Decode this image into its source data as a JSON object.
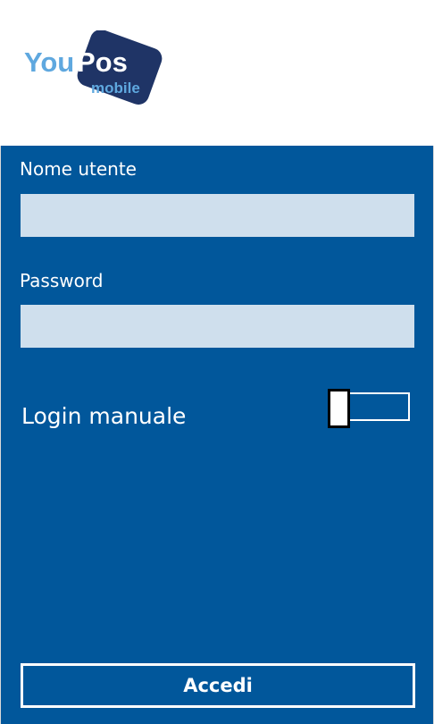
{
  "logo": {
    "text_you": "You",
    "text_pos": "Pos",
    "text_mobile": "mobile",
    "color_light": "#5fa8df",
    "color_dark": "#1f3466"
  },
  "form": {
    "username_label": "Nome utente",
    "username_value": "",
    "password_label": "Password",
    "password_value": "",
    "manual_login_label": "Login manuale",
    "manual_login_on": false,
    "submit_label": "Accedi"
  },
  "colors": {
    "panel_bg": "#01579b",
    "input_bg": "#cfdfed",
    "text": "#ffffff"
  },
  "icons": {
    "logo": "youpos-mobile-logo"
  }
}
